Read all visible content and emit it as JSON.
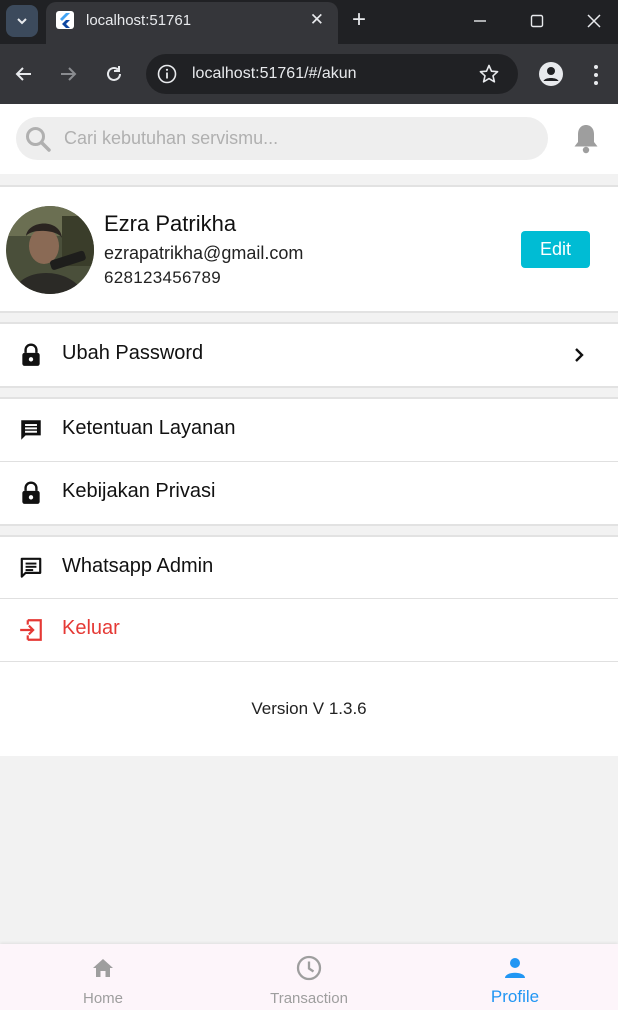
{
  "browser": {
    "tab_title": "localhost:51761",
    "url": "localhost:51761/#/akun"
  },
  "search": {
    "placeholder": "Cari kebutuhan servismu..."
  },
  "profile": {
    "name": "Ezra Patrikha",
    "email": "ezrapatrikha@gmail.com",
    "phone": "628123456789",
    "edit_label": "Edit"
  },
  "menu": {
    "change_password": "Ubah Password",
    "terms": "Ketentuan Layanan",
    "privacy": "Kebijakan Privasi",
    "whatsapp": "Whatsapp Admin",
    "logout": "Keluar"
  },
  "version": "Version V 1.3.6",
  "bottom_nav": {
    "home": "Home",
    "transaction": "Transaction",
    "profile": "Profile"
  },
  "colors": {
    "accent": "#00bcd4",
    "active_nav": "#2196f3",
    "logout": "#e53935"
  }
}
